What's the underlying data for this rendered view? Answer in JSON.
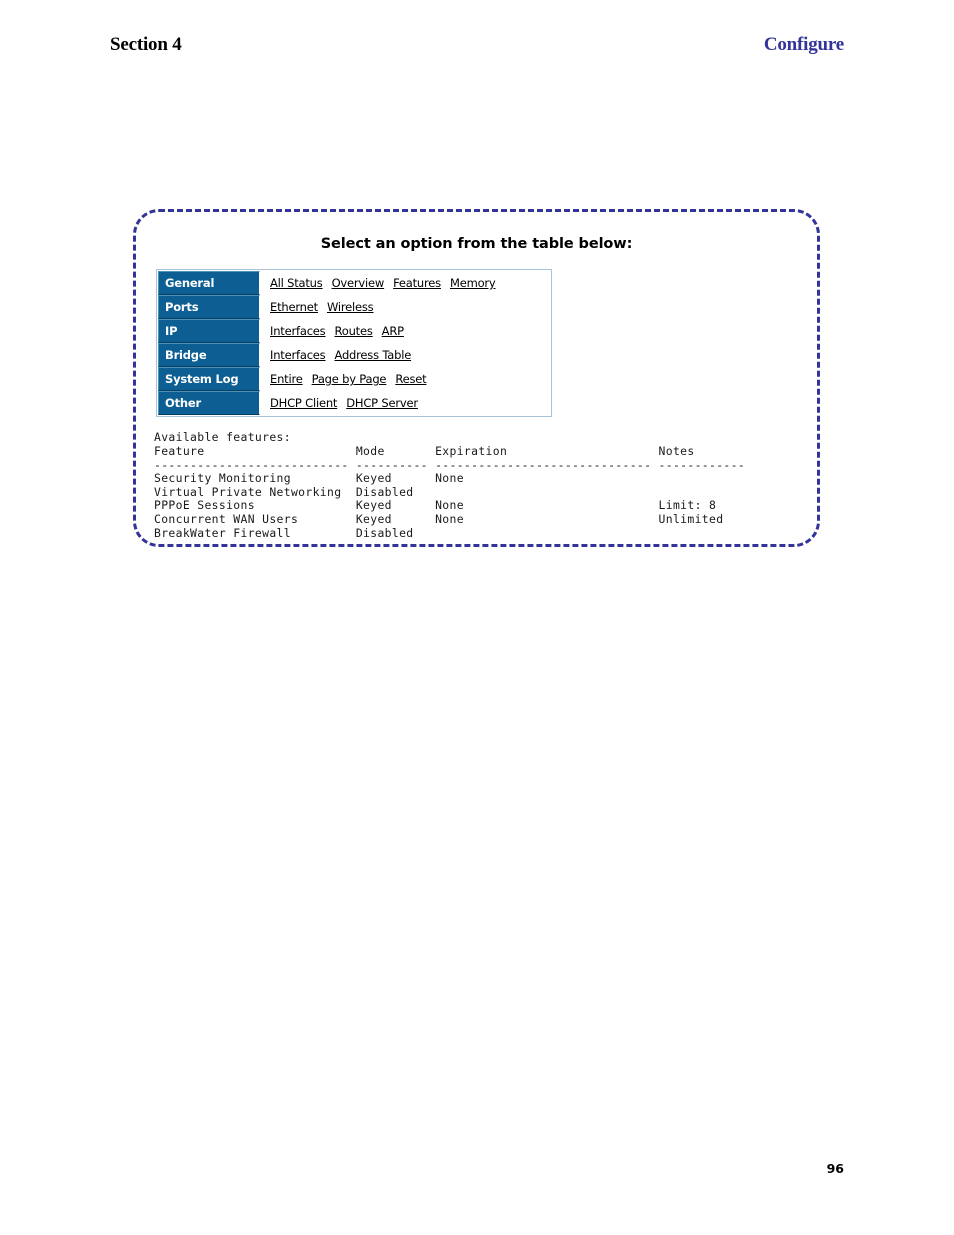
{
  "header": {
    "section": "Section 4",
    "chapter": "Configure",
    "chapter_color": "#333399"
  },
  "panel": {
    "title": "Select an option from the table below:",
    "frame_color": "#333399",
    "category_bg": "#0d5f93",
    "category_text_color": "#ffffff",
    "rows": [
      {
        "category": "General",
        "links": [
          "All Status",
          "Overview",
          "Features",
          "Memory"
        ]
      },
      {
        "category": "Ports",
        "links": [
          "Ethernet",
          "Wireless"
        ]
      },
      {
        "category": "IP",
        "links": [
          "Interfaces",
          "Routes",
          "ARP"
        ]
      },
      {
        "category": "Bridge",
        "links": [
          "Interfaces",
          "Address Table"
        ]
      },
      {
        "category": "System Log",
        "links": [
          "Entire",
          "Page by Page",
          "Reset"
        ]
      },
      {
        "category": "Other",
        "links": [
          "DHCP Client",
          "DHCP Server"
        ]
      }
    ],
    "console": {
      "heading": "Available features:",
      "columns": [
        "Feature",
        "Mode",
        "Expiration",
        "Notes"
      ],
      "rows": [
        {
          "feature": "Security Monitoring",
          "mode": "Keyed",
          "expiration": "None",
          "notes": ""
        },
        {
          "feature": "Virtual Private Networking",
          "mode": "Disabled",
          "expiration": "",
          "notes": ""
        },
        {
          "feature": "PPPoE Sessions",
          "mode": "Keyed",
          "expiration": "None",
          "notes": "Limit: 8"
        },
        {
          "feature": "Concurrent WAN Users",
          "mode": "Keyed",
          "expiration": "None",
          "notes": "Unlimited"
        },
        {
          "feature": "BreakWater Firewall",
          "mode": "Disabled",
          "expiration": "",
          "notes": ""
        }
      ],
      "text": "Available features:\nFeature                     Mode       Expiration                     Notes\n--------------------------- ---------- ------------------------------ ------------\nSecurity Monitoring         Keyed      None\nVirtual Private Networking  Disabled\nPPPoE Sessions              Keyed      None                           Limit: 8\nConcurrent WAN Users        Keyed      None                           Unlimited\nBreakWater Firewall         Disabled"
    }
  },
  "footer": {
    "page_number": "96"
  }
}
